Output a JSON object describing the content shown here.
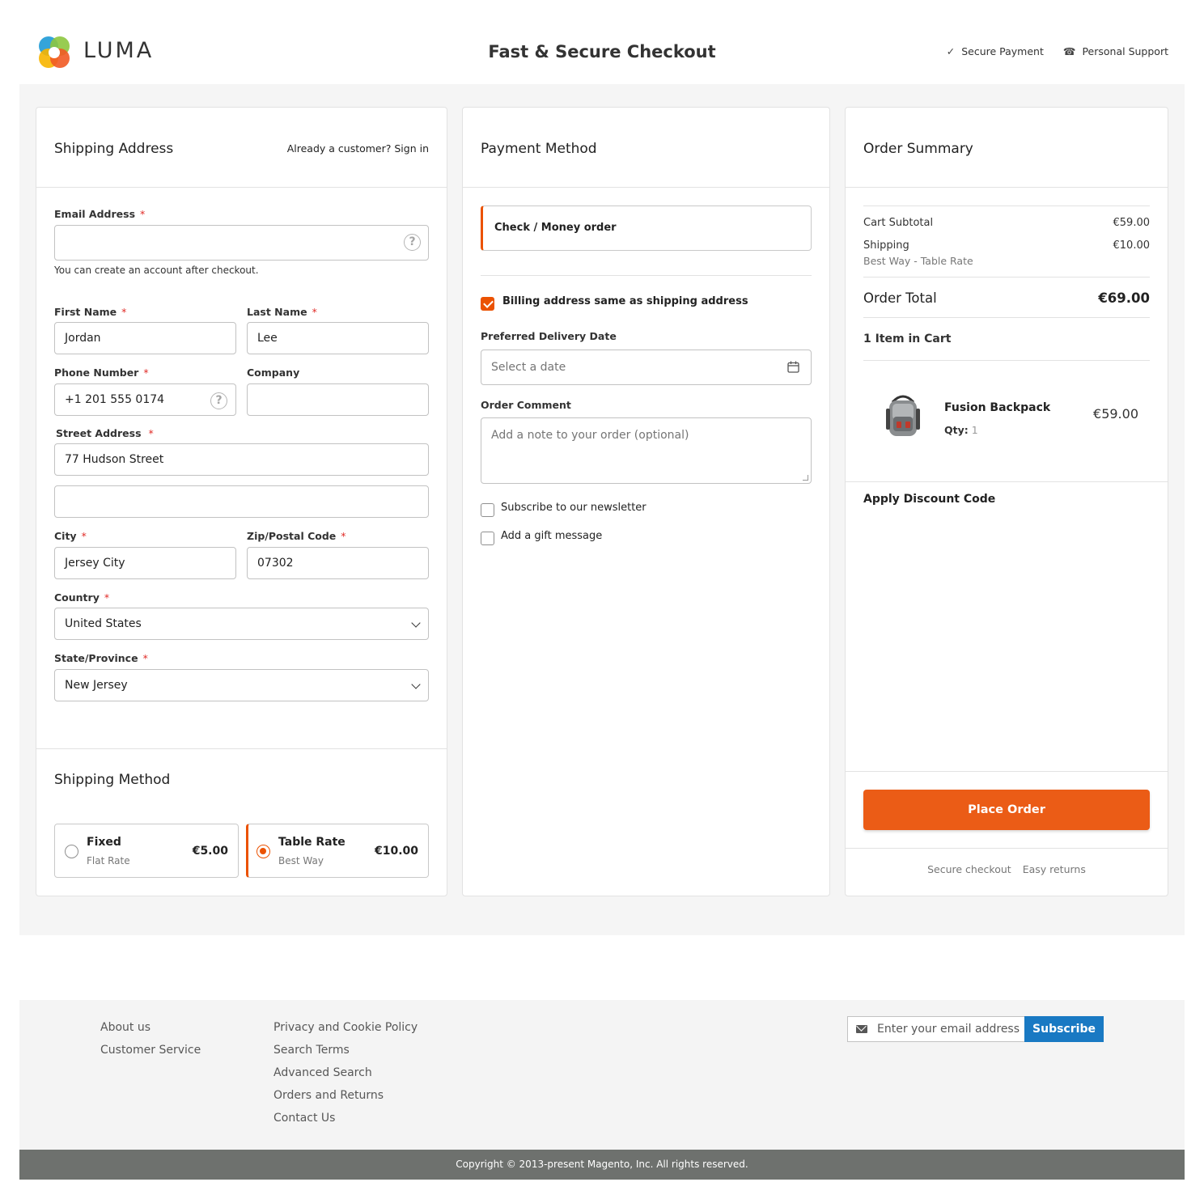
{
  "header": {
    "logo_text": "LUMA",
    "title": "Fast & Secure Checkout",
    "badges": [
      {
        "icon": "check-icon",
        "glyph": "✓",
        "label": "Secure Payment"
      },
      {
        "icon": "phone-icon",
        "glyph": "☎",
        "label": "Personal Support"
      }
    ]
  },
  "shipping": {
    "title": "Shipping Address",
    "signin_text": "Already a customer? Sign in",
    "email": {
      "label": "Email Address",
      "value": "",
      "note": "You can create an account after checkout."
    },
    "first_name": {
      "label": "First Name",
      "value": "Jordan"
    },
    "last_name": {
      "label": "Last Name",
      "value": "Lee"
    },
    "phone": {
      "label": "Phone Number",
      "value": "+1 201 555 0174"
    },
    "company": {
      "label": "Company",
      "value": ""
    },
    "street": {
      "label": "Street Address",
      "line1": "77 Hudson Street",
      "line2": ""
    },
    "city": {
      "label": "City",
      "value": "Jersey City"
    },
    "zip": {
      "label": "Zip/Postal Code",
      "value": "07302"
    },
    "country": {
      "label": "Country",
      "value": "United States"
    },
    "state": {
      "label": "State/Province",
      "value": "New Jersey"
    },
    "required_mark": "*"
  },
  "shipping_method": {
    "title": "Shipping Method",
    "options": [
      {
        "name": "Fixed",
        "sub": "Flat Rate",
        "price": "€5.00",
        "selected": false
      },
      {
        "name": "Table Rate",
        "sub": "Best Way",
        "price": "€10.00",
        "selected": true
      }
    ]
  },
  "payment": {
    "title": "Payment Method",
    "method": "Check / Money order",
    "billing_same": {
      "label": "Billing address same as shipping address",
      "checked": true
    },
    "delivery_date": {
      "label": "Preferred Delivery Date",
      "placeholder": "Select a date"
    },
    "comment": {
      "label": "Order Comment",
      "placeholder": "Add a note to your order (optional)"
    },
    "newsletter": {
      "label": "Subscribe to our newsletter",
      "checked": false
    },
    "gift": {
      "label": "Add a gift message",
      "checked": false
    }
  },
  "summary": {
    "title": "Order Summary",
    "subtotal_label": "Cart Subtotal",
    "subtotal": "€59.00",
    "shipping_label": "Shipping",
    "shipping": "€10.00",
    "shipping_method": "Best Way - Table Rate",
    "total_label": "Order Total",
    "total": "€69.00",
    "items_count": "1 Item in Cart",
    "item": {
      "name": "Fusion Backpack",
      "qty_label": "Qty:",
      "qty": "1",
      "price": "€59.00"
    },
    "discount_label": "Apply Discount Code",
    "place_order": "Place Order",
    "trust": [
      "Secure checkout",
      "Easy returns"
    ]
  },
  "footer": {
    "col1": [
      "About us",
      "Customer Service"
    ],
    "col2": [
      "Privacy and Cookie Policy",
      "Search Terms",
      "Advanced Search",
      "Orders and Returns",
      "Contact Us"
    ],
    "newsletter_placeholder": "Enter your email address",
    "subscribe": "Subscribe",
    "copyright": "Copyright © 2013-present Magento, Inc. All rights reserved."
  },
  "colors": {
    "accent": "#eb5202",
    "link_blue": "#1979c3",
    "page_bg": "#f5f5f5"
  }
}
